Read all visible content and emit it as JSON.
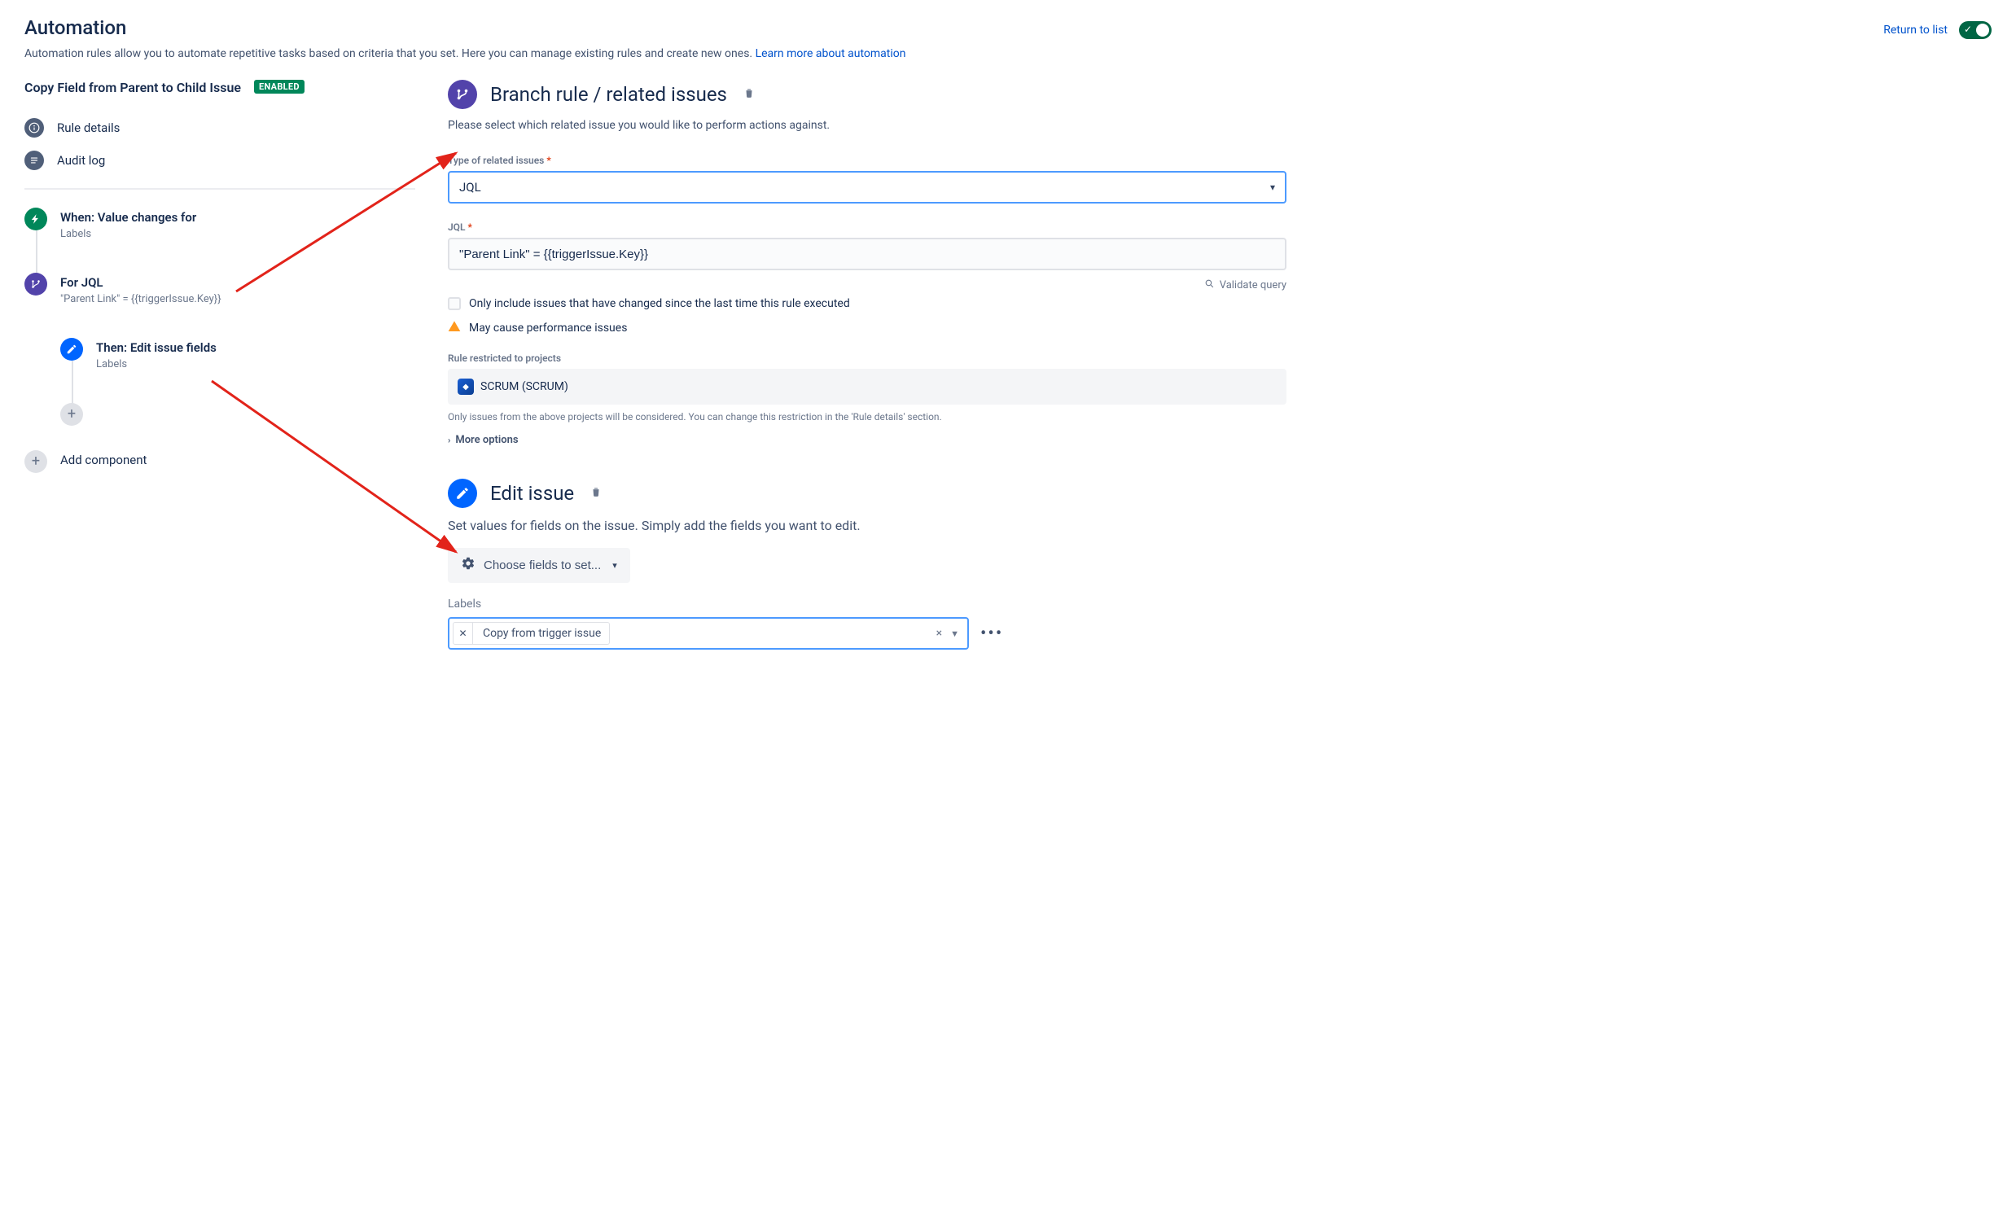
{
  "header": {
    "title": "Automation",
    "description_prefix": "Automation rules allow you to automate repetitive tasks based on criteria that you set. Here you can manage existing rules and create new ones. ",
    "learn_link_text": "Learn more about automation",
    "return_link": "Return to list"
  },
  "rule": {
    "name": "Copy Field from Parent to Child Issue",
    "status_badge": "ENABLED"
  },
  "side_nav": {
    "details": "Rule details",
    "audit": "Audit log"
  },
  "timeline": {
    "trigger_title": "When: Value changes for",
    "trigger_sub": "Labels",
    "branch_title": "For JQL",
    "branch_sub": "\"Parent Link\" = {{triggerIssue.Key}}",
    "action_title": "Then: Edit issue fields",
    "action_sub": "Labels",
    "add_component": "Add component"
  },
  "branch_panel": {
    "title": "Branch rule / related issues",
    "description": "Please select which related issue you would like to perform actions against.",
    "type_label": "Type of related issues",
    "type_value": "JQL",
    "jql_label": "JQL",
    "jql_value": "\"Parent Link\" = {{triggerIssue.Key}}",
    "validate_text": "Validate query",
    "checkbox_text": "Only include issues that have changed since the last time this rule executed",
    "warning_text": "May cause performance issues",
    "restrict_label": "Rule restricted to projects",
    "project_name": "SCRUM (SCRUM)",
    "restrict_help": "Only issues from the above projects will be considered. You can change this restriction in the 'Rule details' section.",
    "more_options": "More options"
  },
  "edit_panel": {
    "title": "Edit issue",
    "description": "Set values for fields on the issue. Simply add the fields you want to edit.",
    "choose_button": "Choose fields to set...",
    "labels_label": "Labels",
    "chip_text": "Copy from trigger issue"
  }
}
